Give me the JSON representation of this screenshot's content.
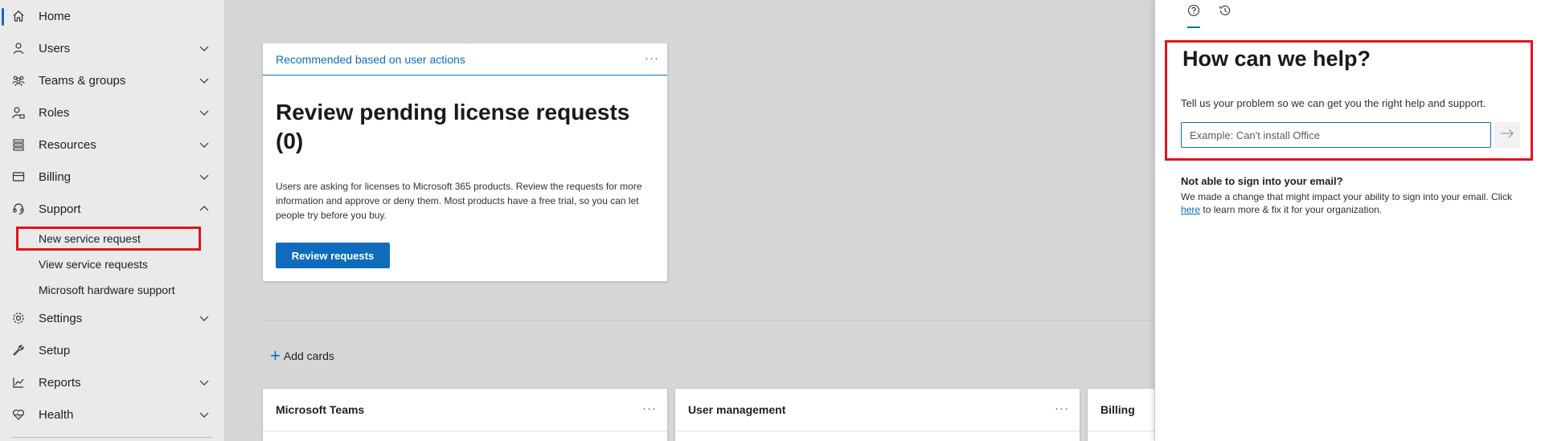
{
  "sidebar": {
    "items": [
      {
        "label": "Home",
        "icon": "home-icon"
      },
      {
        "label": "Users",
        "icon": "user-icon"
      },
      {
        "label": "Teams & groups",
        "icon": "teams-icon"
      },
      {
        "label": "Roles",
        "icon": "roles-icon"
      },
      {
        "label": "Resources",
        "icon": "resources-icon"
      },
      {
        "label": "Billing",
        "icon": "billing-icon"
      },
      {
        "label": "Support",
        "icon": "headset-icon"
      },
      {
        "label": "Settings",
        "icon": "gear-icon"
      },
      {
        "label": "Setup",
        "icon": "wrench-icon"
      },
      {
        "label": "Reports",
        "icon": "chart-icon"
      },
      {
        "label": "Health",
        "icon": "heart-icon"
      }
    ],
    "support_sub": [
      "New service request",
      "View service requests",
      "Microsoft hardware support"
    ]
  },
  "recommended_card": {
    "header": "Recommended based on user actions",
    "more": "···",
    "title": "Review pending license requests (0)",
    "description": "Users are asking for licenses to Microsoft 365 products. Review the requests for more information and approve or deny them. Most products have a free trial, so you can let people try before you buy.",
    "button": "Review requests"
  },
  "add_cards": "Add cards",
  "cards": [
    {
      "title": "Microsoft Teams",
      "more": "···"
    },
    {
      "title": "User management",
      "more": "···"
    },
    {
      "title": "Billing"
    }
  ],
  "help_panel": {
    "title": "How can we help?",
    "subtitle": "Tell us your problem so we can get you the right help and support.",
    "input_placeholder": "Example: Can't install Office",
    "notice_title": "Not able to sign into your email?",
    "notice_text_before": "We made a change that might impact your ability to sign into your email. Click ",
    "notice_link": "here",
    "notice_text_after": " to learn more & fix it for your organization."
  },
  "colors": {
    "accent": "#0f6cbd",
    "highlight": "#e0141e"
  }
}
